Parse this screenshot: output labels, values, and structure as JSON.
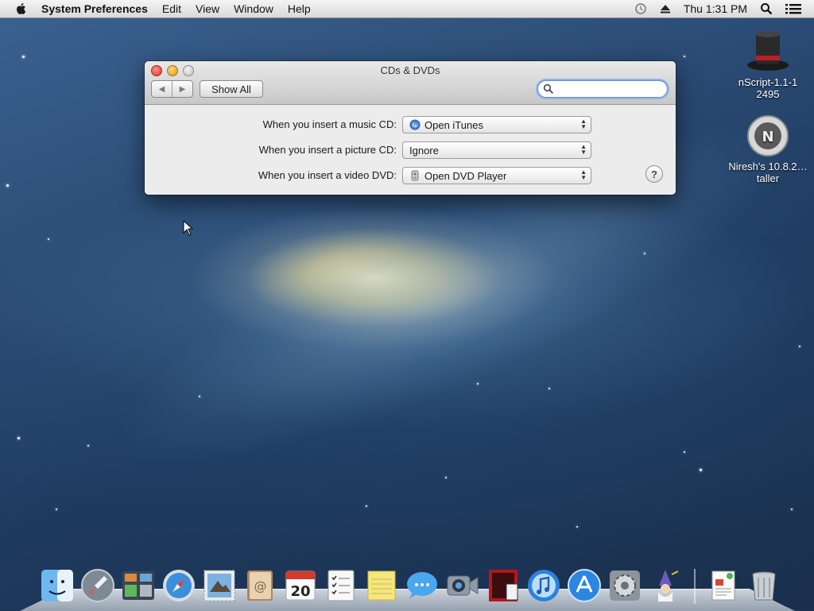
{
  "menubar": {
    "app_name": "System Preferences",
    "items": [
      "Edit",
      "View",
      "Window",
      "Help"
    ],
    "clock": "Thu 1:31 PM"
  },
  "window": {
    "title": "CDs & DVDs",
    "show_all_label": "Show All",
    "search_value": "",
    "rows": [
      {
        "label": "When you insert a music CD:",
        "value": "Open iTunes",
        "icon": "itunes-icon"
      },
      {
        "label": "When you insert a picture CD:",
        "value": "Ignore",
        "icon": ""
      },
      {
        "label": "When you insert a video DVD:",
        "value": "Open DVD Player",
        "icon": "dvd-player-icon"
      }
    ],
    "help_label": "?"
  },
  "desktop_icons": [
    {
      "label": "nScript-1.1-1 2495",
      "icon": "top-hat-icon"
    },
    {
      "label": "Niresh's 10.8.2…taller",
      "icon": "disk-image-icon"
    }
  ],
  "calendar_day": "20",
  "colors": {
    "accent": "#6a8ec4",
    "close": "#d8372c",
    "minimize": "#dd9a1a"
  }
}
